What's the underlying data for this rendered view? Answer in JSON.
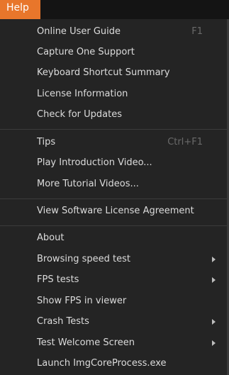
{
  "menubar": {
    "active_menu": "Help"
  },
  "menu": {
    "group1": [
      {
        "label": "Online User Guide",
        "shortcut": "F1"
      },
      {
        "label": "Capture One Support"
      },
      {
        "label": "Keyboard Shortcut Summary"
      },
      {
        "label": "License Information"
      },
      {
        "label": "Check for Updates"
      }
    ],
    "group2": [
      {
        "label": "Tips",
        "shortcut": "Ctrl+F1"
      },
      {
        "label": "Play Introduction Video..."
      },
      {
        "label": "More Tutorial Videos..."
      }
    ],
    "group3": [
      {
        "label": "View Software License Agreement"
      }
    ],
    "group4": [
      {
        "label": "About"
      },
      {
        "label": "Browsing speed test",
        "submenu": true
      },
      {
        "label": "FPS tests",
        "submenu": true
      },
      {
        "label": "Show FPS in viewer"
      },
      {
        "label": "Crash Tests",
        "submenu": true
      },
      {
        "label": "Test Welcome Screen",
        "submenu": true
      },
      {
        "label": "Launch ImgCoreProcess.exe"
      }
    ]
  },
  "colors": {
    "menubar_bg": "#141414",
    "active_tab_bg": "#e8762b",
    "menu_bg": "#242424",
    "text": "#dcdcdc",
    "shortcut_text": "#6a6a6a",
    "separator": "#3c3c3c"
  }
}
